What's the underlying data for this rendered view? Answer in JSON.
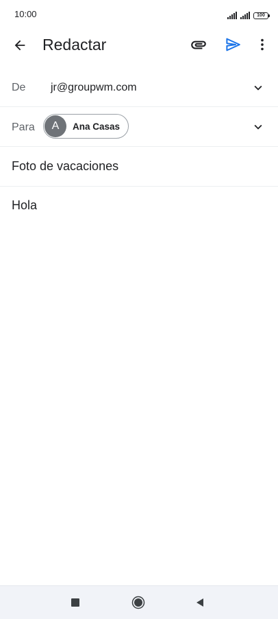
{
  "status_bar": {
    "time": "10:00",
    "battery": "100"
  },
  "app_bar": {
    "title": "Redactar",
    "back_icon": "arrow-back-icon",
    "attach_icon": "paperclip-icon",
    "send_icon": "send-icon",
    "more_icon": "more-vert-icon"
  },
  "compose": {
    "from_label": "De",
    "from_value": "jr@groupwm.com",
    "to_label": "Para",
    "recipients": [
      {
        "initial": "A",
        "name": "Ana Casas"
      }
    ],
    "subject": "Foto de vacaciones",
    "body": "Hola"
  },
  "nav_bar": {
    "recent_icon": "square-icon",
    "home_icon": "circle-icon",
    "back_icon": "triangle-back-icon"
  },
  "colors": {
    "accent": "#1a73e8",
    "text": "#202124",
    "secondary_text": "#5f6368",
    "divider": "#eceff1",
    "chip_avatar": "#6f7378",
    "nav_background": "#f1f3f8"
  }
}
